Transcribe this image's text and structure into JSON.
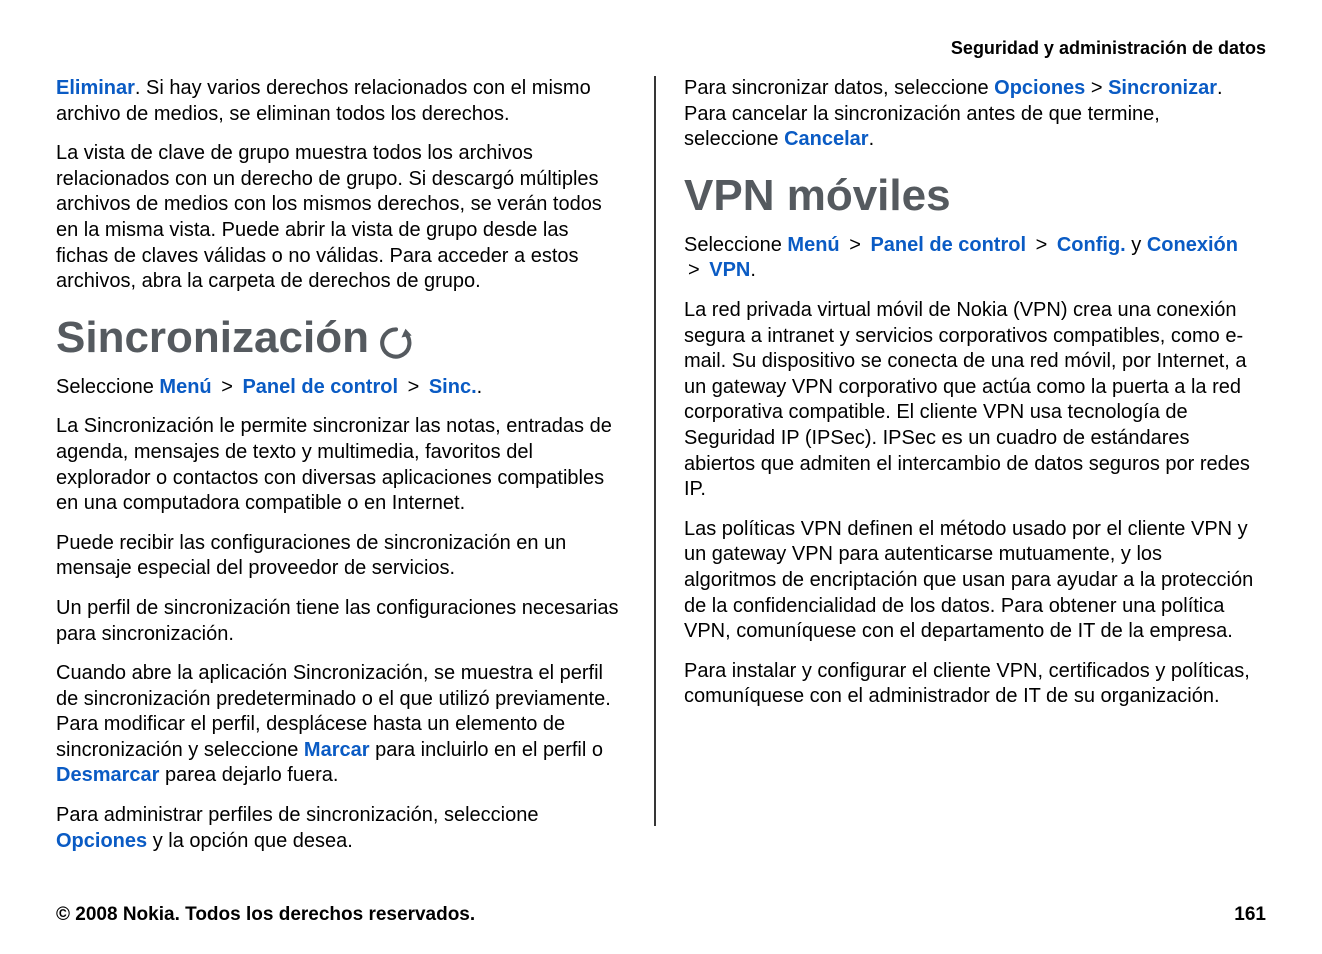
{
  "header": {
    "title": "Seguridad y administración de datos"
  },
  "left": {
    "p1_a": "Eliminar",
    "p1_b": ". Si hay varios derechos relacionados con el mismo archivo de medios, se eliminan todos los derechos.",
    "p2": "La vista de clave de grupo muestra todos los archivos relacionados con un derecho de grupo. Si descargó múltiples archivos de medios con los mismos derechos, se verán todos en la misma vista. Puede abrir la vista de grupo desde las fichas de claves válidas o no válidas. Para acceder a estos archivos, abra la carpeta de derechos de grupo.",
    "h1": "Sincronización",
    "nav": {
      "pre": "Seleccione ",
      "a": "Menú",
      "b": "Panel de control",
      "c": "Sinc.",
      "tail": "."
    },
    "p4": "La Sincronización le permite sincronizar las notas, entradas de agenda, mensajes de texto y multimedia, favoritos del explorador o contactos con diversas aplicaciones compatibles en una computadora compatible o en Internet.",
    "p5": "Puede recibir las configuraciones de sincronización en un mensaje especial del proveedor de servicios.",
    "p6": "Un perfil de sincronización tiene las configuraciones necesarias para sincronización.",
    "p7_a": "Cuando abre la aplicación Sincronización, se muestra el perfil de sincronización predeterminado o el que utilizó previamente. Para modificar el perfil, desplácese hasta un elemento de sincronización y seleccione ",
    "p7_m": "Marcar",
    "p7_b": " para incluirlo en el perfil o ",
    "p7_d": "Desmarcar",
    "p7_c": " parea dejarlo fuera.",
    "p8_a": "Para administrar perfiles de sincronización, seleccione ",
    "p8_o": "Opciones",
    "p8_b": " y la opción que desea."
  },
  "right": {
    "p1_a": "Para sincronizar datos, seleccione ",
    "p1_o": "Opciones",
    "p1_b": " > ",
    "p1_s": "Sincronizar",
    "p1_c": ". Para cancelar la sincronización antes de que termine, seleccione ",
    "p1_ca": "Cancelar",
    "p1_d": ".",
    "h1": "VPN móviles",
    "nav": {
      "pre": "Seleccione ",
      "a": "Menú",
      "b": "Panel de control",
      "c": "Config.",
      "and": " y ",
      "d": "Conexión",
      "e": "VPN",
      "tail": "."
    },
    "p3": "La red privada virtual móvil de Nokia (VPN) crea una conexión segura a intranet y servicios corporativos compatibles, como e-mail. Su dispositivo se conecta de una red móvil, por Internet, a un gateway VPN corporativo que actúa como la puerta a la red corporativa compatible. El cliente VPN usa tecnología de Seguridad IP (IPSec). IPSec es un cuadro de estándares abiertos que admiten el intercambio de datos seguros por redes IP.",
    "p4": "Las políticas VPN definen el método usado por el cliente VPN y un gateway VPN para autenticarse mutuamente, y los algoritmos de encriptación que usan para ayudar a la protección de la confidencialidad de los datos. Para obtener una política VPN, comuníquese con el departamento de IT de la empresa.",
    "p5": "Para instalar y configurar el cliente VPN, certificados y políticas, comuníquese con el administrador de IT de su organización."
  },
  "footer": {
    "left": "© 2008 Nokia. Todos los derechos reservados.",
    "right": "161"
  }
}
